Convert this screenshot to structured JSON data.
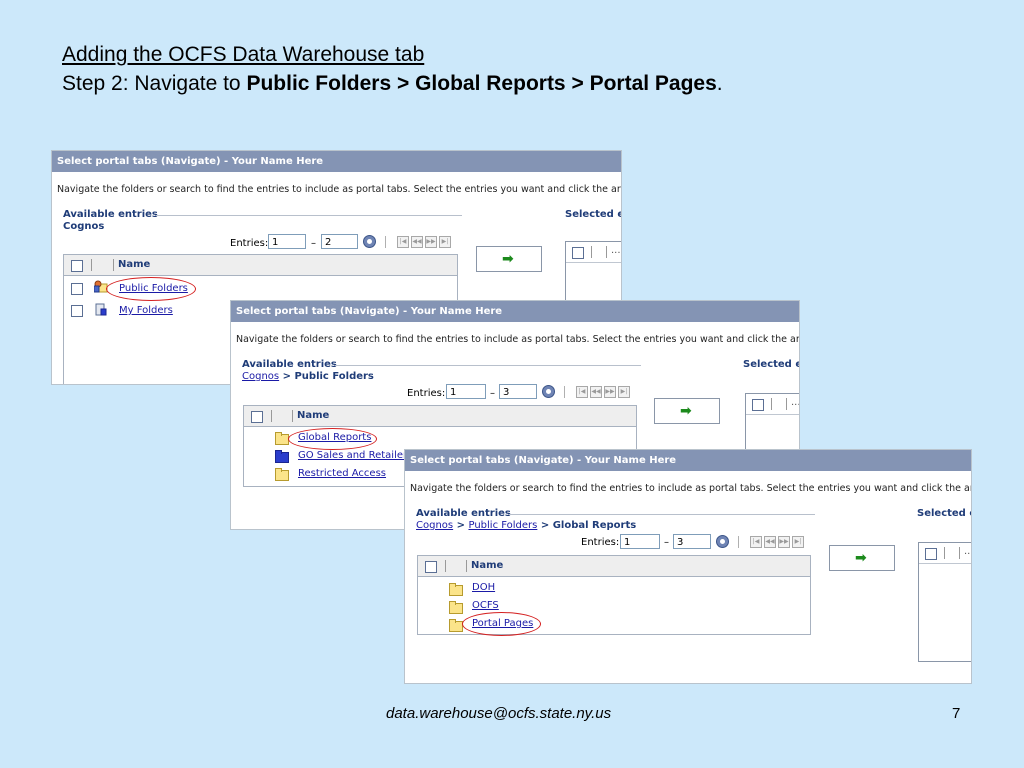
{
  "slide": {
    "title_line1": "Adding the OCFS Data Warehouse tab",
    "title_line2_prefix": "Step 2: Navigate to ",
    "path_1": "Public Folders",
    "path_sep_1": " > ",
    "path_2": "Global Reports",
    "path_sep_2": " > ",
    "path_3": "Portal Pages",
    "title_line2_suffix": ".",
    "footer_email": "data.warehouse@ocfs.state.ny.us",
    "page_number": "7"
  },
  "shots": [
    {
      "title_bar": "Select portal tabs (Navigate) - Your Name Here",
      "instructions": "Navigate the folders or search to find the entries to include as portal tabs. Select the entries you want and click the arrow button",
      "available_label": "Available entries",
      "selected_label": "Selected er",
      "breadcrumb_text": "Cognos",
      "entries_label": "Entries:",
      "entries_from": "1",
      "entries_to": "2",
      "column_name": "Name",
      "selected_header": "...",
      "rows": [
        {
          "label": "Public Folders",
          "icon": "public-folders-icon",
          "highlighted": true
        },
        {
          "label": "My Folders",
          "icon": "my-folders-icon",
          "highlighted": false
        }
      ]
    },
    {
      "title_bar": "Select portal tabs (Navigate) - Your Name Here",
      "instructions": "Navigate the folders or search to find the entries to include as portal tabs. Select the entries you want and click the arrow button",
      "available_label": "Available entries",
      "selected_label": "Selected e",
      "breadcrumb_links": [
        "Cognos"
      ],
      "breadcrumb_sep": " > ",
      "breadcrumb_current": "Public Folders",
      "entries_label": "Entries:",
      "entries_from": "1",
      "entries_to": "3",
      "column_name": "Name",
      "selected_header": "...",
      "rows": [
        {
          "label": "Global Reports",
          "icon": "folder-icon",
          "highlighted": true
        },
        {
          "label": "GO Sales and Retailers",
          "icon": "package-icon",
          "highlighted": false
        },
        {
          "label": "Restricted Access",
          "icon": "folder-icon",
          "highlighted": false
        }
      ]
    },
    {
      "title_bar": "Select portal tabs (Navigate) - Your Name Here",
      "instructions": "Navigate the folders or search to find the entries to include as portal tabs. Select the entries you want and click the arrow button",
      "available_label": "Available entries",
      "selected_label": "Selected e",
      "breadcrumb_links": [
        "Cognos",
        "Public Folders"
      ],
      "breadcrumb_sep": " > ",
      "breadcrumb_current": "Global Reports",
      "entries_label": "Entries:",
      "entries_from": "1",
      "entries_to": "3",
      "column_name": "Name",
      "selected_header": "...",
      "rows": [
        {
          "label": "DOH",
          "icon": "folder-icon",
          "highlighted": false
        },
        {
          "label": "OCFS",
          "icon": "folder-icon",
          "highlighted": false
        },
        {
          "label": "Portal Pages",
          "icon": "folder-icon",
          "highlighted": true
        }
      ]
    }
  ],
  "nav_buttons": [
    "first-page-icon",
    "previous-page-icon",
    "next-page-icon",
    "last-page-icon"
  ],
  "colors": {
    "slide_background": "#cce8fa",
    "title_bar": "#8494b4",
    "highlight_circle": "#d42020",
    "link": "#1a1aa6",
    "arrow": "#1c8a1c"
  }
}
